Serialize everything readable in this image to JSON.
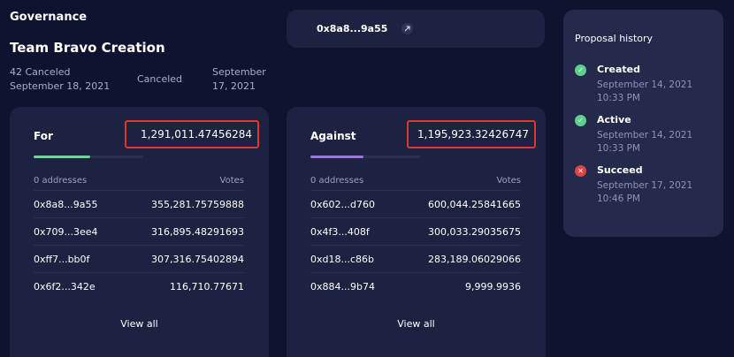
{
  "header": {
    "section": "Governance",
    "proposal_title": "Team Bravo Creation",
    "meta_left_line1": "42 Canceled",
    "meta_left_line2": "September 18, 2021",
    "status": "Canceled",
    "meta_right_line1": "September",
    "meta_right_line2": "17, 2021"
  },
  "proposer": {
    "address": "0x8a8...9a55",
    "link_icon": "external-link-icon"
  },
  "for_card": {
    "label": "For",
    "total": "1,291,011.47456284",
    "progress": 0.52,
    "bar_color": "#6fd39b",
    "col_addresses": "0 addresses",
    "col_votes": "Votes",
    "rows": [
      {
        "address": "0x8a8...9a55",
        "votes": "355,281.75759888"
      },
      {
        "address": "0x709...3ee4",
        "votes": "316,895.48291693"
      },
      {
        "address": "0xff7...bb0f",
        "votes": "307,316.75402894"
      },
      {
        "address": "0x6f2...342e",
        "votes": "116,710.77671"
      }
    ],
    "view_all": "View all"
  },
  "against_card": {
    "label": "Against",
    "total": "1,195,923.32426747",
    "progress": 0.48,
    "bar_color": "#9a77e0",
    "col_addresses": "0 addresses",
    "col_votes": "Votes",
    "rows": [
      {
        "address": "0x602...d760",
        "votes": "600,044.25841665"
      },
      {
        "address": "0x4f3...408f",
        "votes": "300,033.29035675"
      },
      {
        "address": "0xd18...c86b",
        "votes": "283,189.06029066"
      },
      {
        "address": "0x884...9b74",
        "votes": "9,999.9936"
      }
    ],
    "view_all": "View all"
  },
  "history": {
    "title": "Proposal history",
    "items": [
      {
        "name": "Created",
        "time": "September 14, 2021 10:33 PM",
        "icon": "check-icon"
      },
      {
        "name": "Active",
        "time": "September 14, 2021 10:33 PM",
        "icon": "check-icon"
      },
      {
        "name": "Succeed",
        "time": "September 17, 2021 10:46 PM",
        "icon": "x-icon"
      }
    ]
  }
}
